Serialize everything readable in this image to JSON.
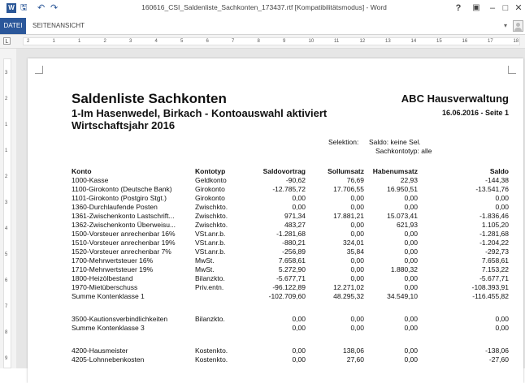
{
  "window": {
    "title": "160616_CSI_Saldenliste_Sachkonten_173437.rtf [Kompatibilitätsmodus] - Word",
    "app_icon_label": "W",
    "undo_label": "↶",
    "redo_label": "↷",
    "help_label": "?",
    "minimize_label": "–",
    "maximize_label": "□",
    "close_label": "✕"
  },
  "ribbon": {
    "file_tab": "DATEI",
    "view_tab": "SEITENANSICHT"
  },
  "ruler": {
    "tab_selector": "L",
    "h_numbers": [
      "2",
      "1",
      "1",
      "2",
      "3",
      "4",
      "5",
      "6",
      "7",
      "8",
      "9",
      "10",
      "11",
      "12",
      "13",
      "14",
      "15",
      "16",
      "17",
      "18"
    ],
    "v_numbers": [
      "3",
      "2",
      "1",
      "1",
      "2",
      "3",
      "4",
      "5",
      "6",
      "7",
      "8",
      "9"
    ]
  },
  "report": {
    "title": "Saldenliste Sachkonten",
    "company": "ABC Hausverwaltung",
    "subtitle_line1": "1-Im Hasenwedel, Birkach - Kontoauswahl aktiviert",
    "subtitle_line2": "Wirtschaftsjahr 2016",
    "date_page": "16.06.2016 - Seite 1",
    "selection_label": "Selektion:",
    "selection_line1": "Saldo: keine Sel.",
    "selection_line2": "Sachkontotyp: alle",
    "columns": {
      "konto": "Konto",
      "kontotyp": "Kontotyp",
      "saldovortrag": "Saldovortrag",
      "sollumsatz": "Sollumsatz",
      "habenumsatz": "Habenumsatz",
      "saldo": "Saldo"
    },
    "rows": [
      {
        "konto": "1000-Kasse",
        "typ": "Geldkonto",
        "sv": "-90,62",
        "su": "76,69",
        "hu": "22,93",
        "sa": "-144,38"
      },
      {
        "konto": "1100-Girokonto (Deutsche Bank)",
        "typ": "Girokonto",
        "sv": "-12.785,72",
        "su": "17.706,55",
        "hu": "16.950,51",
        "sa": "-13.541,76"
      },
      {
        "konto": "1101-Girokonto (Postgiro Stgt.)",
        "typ": "Girokonto",
        "sv": "0,00",
        "su": "0,00",
        "hu": "0,00",
        "sa": "0,00"
      },
      {
        "konto": "1360-Durchlaufende Posten",
        "typ": "Zwischkto.",
        "sv": "0,00",
        "su": "0,00",
        "hu": "0,00",
        "sa": "0,00"
      },
      {
        "konto": "1361-Zwischenkonto Lastschrift...",
        "typ": "Zwischkto.",
        "sv": "971,34",
        "su": "17.881,21",
        "hu": "15.073,41",
        "sa": "-1.836,46"
      },
      {
        "konto": "1362-Zwischenkonto Überweisu...",
        "typ": "Zwischkto.",
        "sv": "483,27",
        "su": "0,00",
        "hu": "621,93",
        "sa": "1.105,20"
      },
      {
        "konto": "1500-Vorsteuer anrechenbar 16%",
        "typ": "VSt.anr.b.",
        "sv": "-1.281,68",
        "su": "0,00",
        "hu": "0,00",
        "sa": "-1.281,68"
      },
      {
        "konto": "1510-Vorsteuer anrechenbar 19%",
        "typ": "VSt.anr.b.",
        "sv": "-880,21",
        "su": "324,01",
        "hu": "0,00",
        "sa": "-1.204,22"
      },
      {
        "konto": "1520-Vorsteuer anrechenbar 7%",
        "typ": "VSt.anr.b.",
        "sv": "-256,89",
        "su": "35,84",
        "hu": "0,00",
        "sa": "-292,73"
      },
      {
        "konto": "1700-Mehrwertsteuer 16%",
        "typ": "MwSt.",
        "sv": "7.658,61",
        "su": "0,00",
        "hu": "0,00",
        "sa": "7.658,61"
      },
      {
        "konto": "1710-Mehrwertsteuer 19%",
        "typ": "MwSt.",
        "sv": "5.272,90",
        "su": "0,00",
        "hu": "1.880,32",
        "sa": "7.153,22"
      },
      {
        "konto": "1800-Heizölbestand",
        "typ": "Bilanzkto.",
        "sv": "-5.677,71",
        "su": "0,00",
        "hu": "0,00",
        "sa": "-5.677,71"
      },
      {
        "konto": "1970-Mietüberschuss",
        "typ": "Priv.entn.",
        "sv": "-96.122,89",
        "su": "12.271,02",
        "hu": "0,00",
        "sa": "-108.393,91"
      },
      {
        "konto": "Summe Kontenklasse 1",
        "typ": "",
        "sv": "-102.709,60",
        "su": "48.295,32",
        "hu": "34.549,10",
        "sa": "-116.455,82"
      },
      {
        "konto": "3500-Kautionsverbindlichkeiten",
        "typ": "Bilanzkto.",
        "sv": "0,00",
        "su": "0,00",
        "hu": "0,00",
        "sa": "0,00"
      },
      {
        "konto": "Summe Kontenklasse 3",
        "typ": "",
        "sv": "0,00",
        "su": "0,00",
        "hu": "0,00",
        "sa": "0,00"
      },
      {
        "konto": "4200-Hausmeister",
        "typ": "Kostenkto.",
        "sv": "0,00",
        "su": "138,06",
        "hu": "0,00",
        "sa": "-138,06"
      },
      {
        "konto": "4205-Lohnnebenkosten",
        "typ": "Kostenkto.",
        "sv": "0,00",
        "su": "27,60",
        "hu": "0,00",
        "sa": "-27,60"
      }
    ]
  }
}
